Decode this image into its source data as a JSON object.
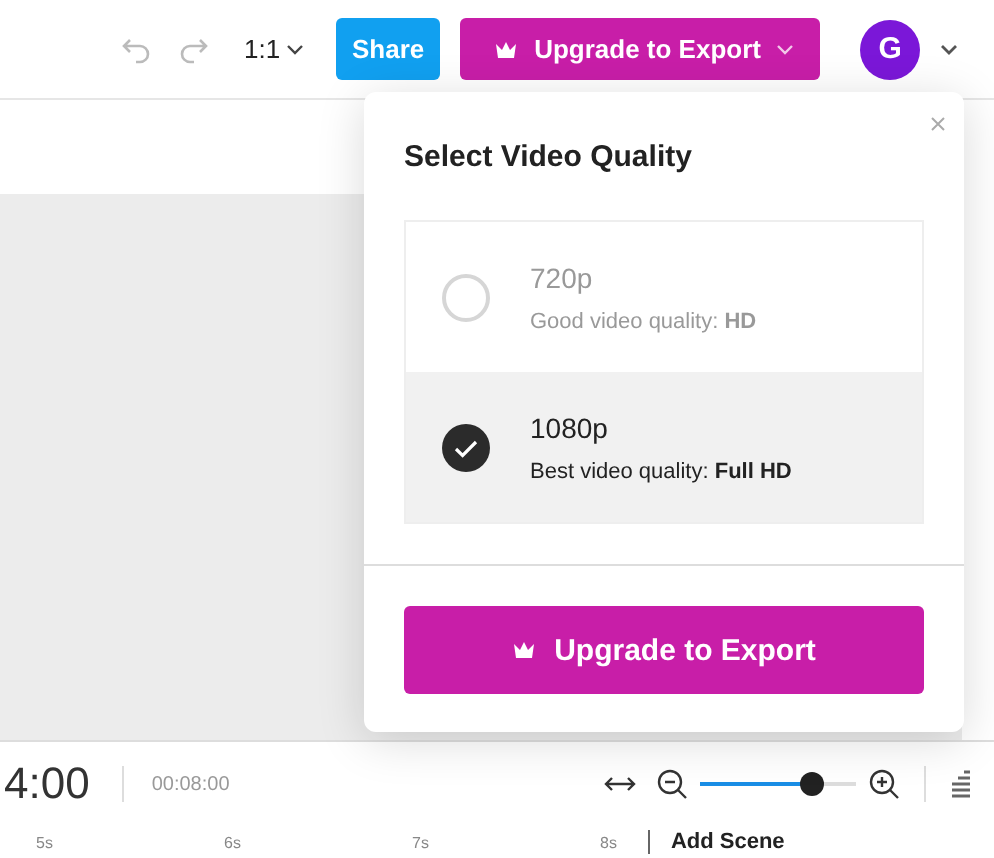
{
  "toolbar": {
    "zoom_ratio": "1:1",
    "share": "Share",
    "upgrade": "Upgrade to Export",
    "avatar": "G"
  },
  "dialog": {
    "title": "Select Video Quality",
    "options": [
      {
        "name": "720p",
        "description": "Good video quality: **HD**",
        "selected": false
      },
      {
        "name": "1080p",
        "description": "Best video quality: **Full HD**",
        "selected": true
      }
    ],
    "button": "Upgrade to Export"
  },
  "timeline": {
    "current_time": "4:00",
    "duration": "00:08:00",
    "zoom": {
      "level": 0.72
    },
    "ruler": [
      "5s",
      "6s",
      "7s",
      "8s"
    ],
    "add_scene": "Add Scene"
  }
}
